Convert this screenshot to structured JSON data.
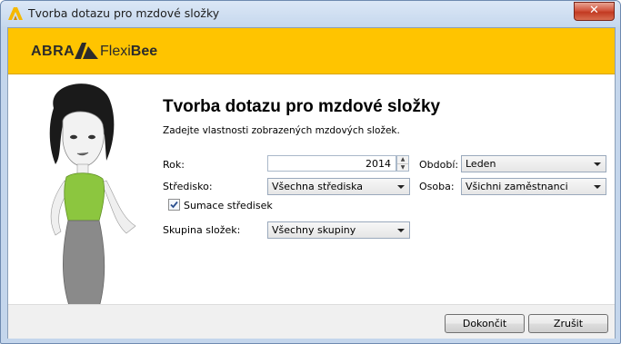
{
  "window": {
    "title": "Tvorba dotazu pro mzdové složky",
    "close_label": "✕"
  },
  "banner": {
    "logo_abra": "ABRA",
    "logo_flexi": "Flexi",
    "logo_bee": "Bee",
    "background": "#ffc400"
  },
  "content": {
    "heading": "Tvorba dotazu pro mzdové složky",
    "subtitle": "Zadejte vlastnosti zobrazených mzdových složek."
  },
  "form": {
    "rok_label": "Rok:",
    "rok_value": "2014",
    "obdobi_label": "Období:",
    "obdobi_value": "Leden",
    "stredisko_label": "Středisko:",
    "stredisko_value": "Všechna střediska",
    "osoba_label": "Osoba:",
    "osoba_value": "Všichni zaměstnanci",
    "sumace_label": "Sumace středisek",
    "sumace_checked": true,
    "skupina_label": "Skupina složek:",
    "skupina_value": "Všechny skupiny"
  },
  "footer": {
    "finish_label": "Dokončit",
    "cancel_label": "Zrušit"
  }
}
